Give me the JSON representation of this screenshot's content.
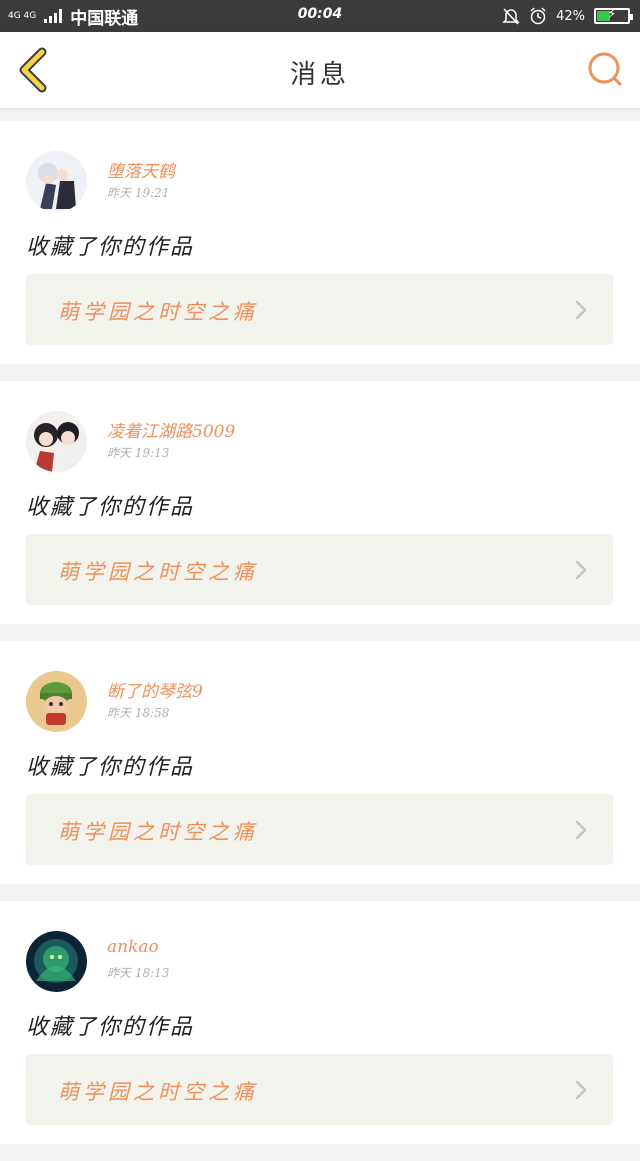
{
  "status_bar": {
    "network": "4G 4G",
    "carrier": "中国联通",
    "time": "00:04",
    "battery": "42%",
    "battery_level": 0.42
  },
  "header": {
    "title": "消息",
    "accent_color": "#f0905a"
  },
  "messages": [
    {
      "username": "堕落天鹤",
      "time": "昨天  19:21",
      "action": "收藏了你的作品",
      "work_title": "萌学园之时空之痛"
    },
    {
      "username": "凌着江湖路5009",
      "time": "昨天  19:13",
      "action": "收藏了你的作品",
      "work_title": "萌学园之时空之痛"
    },
    {
      "username": "断了的琴弦9",
      "time": "昨天  18:58",
      "action": "收藏了你的作品",
      "work_title": "萌学园之时空之痛"
    },
    {
      "username": "ankao",
      "time": "昨天  18:13",
      "action": "收藏了你的作品",
      "work_title": "萌学园之时空之痛"
    }
  ]
}
